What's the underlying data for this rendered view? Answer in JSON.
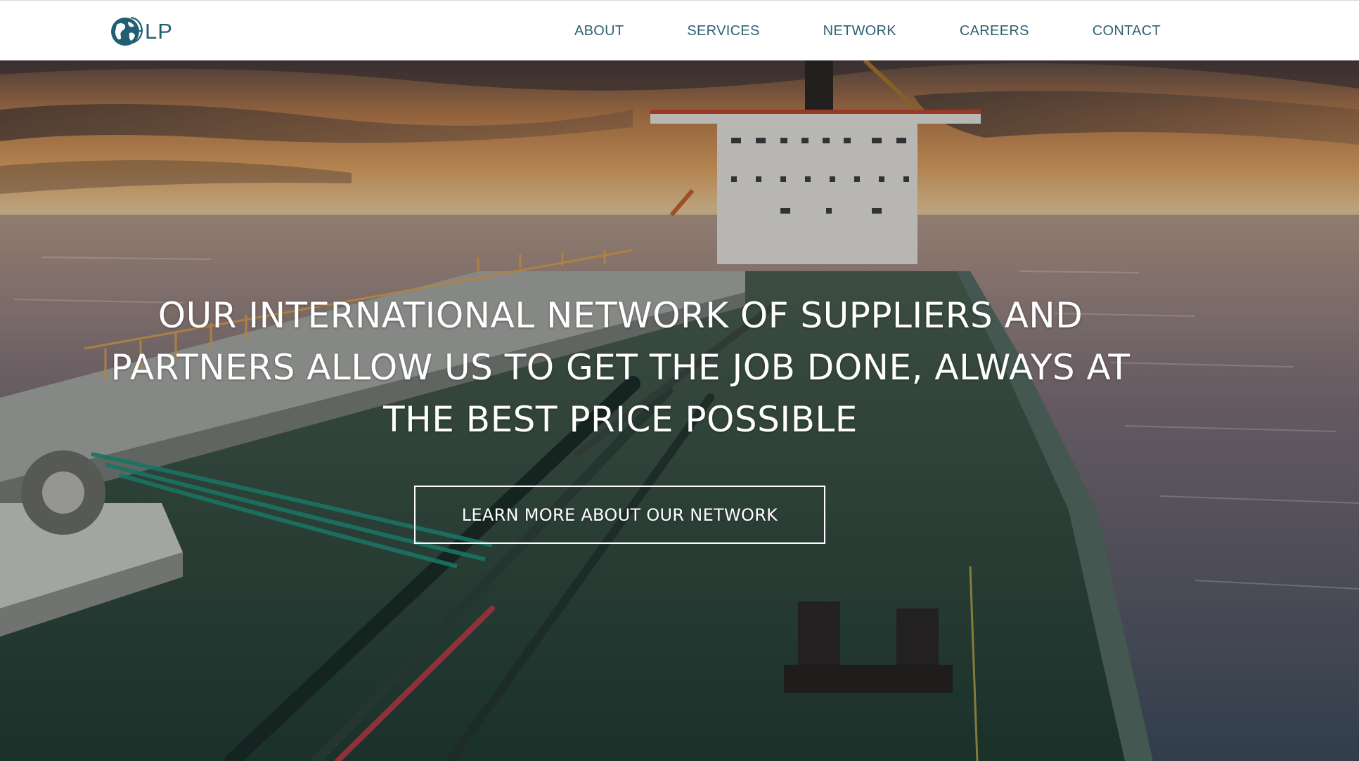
{
  "header": {
    "logo": {
      "icon": "globe-icon",
      "text": "LP",
      "color": "#1f5f74"
    },
    "nav": [
      {
        "label": "ABOUT"
      },
      {
        "label": "SERVICES"
      },
      {
        "label": "NETWORK"
      },
      {
        "label": "CAREERS"
      },
      {
        "label": "CONTACT"
      }
    ],
    "nav_color": "#2f6173"
  },
  "hero": {
    "background_image": "cargo-ship-deck-at-sunset",
    "headline": "OUR INTERNATIONAL NETWORK OF SUPPLIERS AND PARTNERS ALLOW US TO GET THE JOB DONE, ALWAYS AT THE BEST PRICE POSSIBLE",
    "cta_label": "LEARN MORE ABOUT OUR NETWORK"
  }
}
